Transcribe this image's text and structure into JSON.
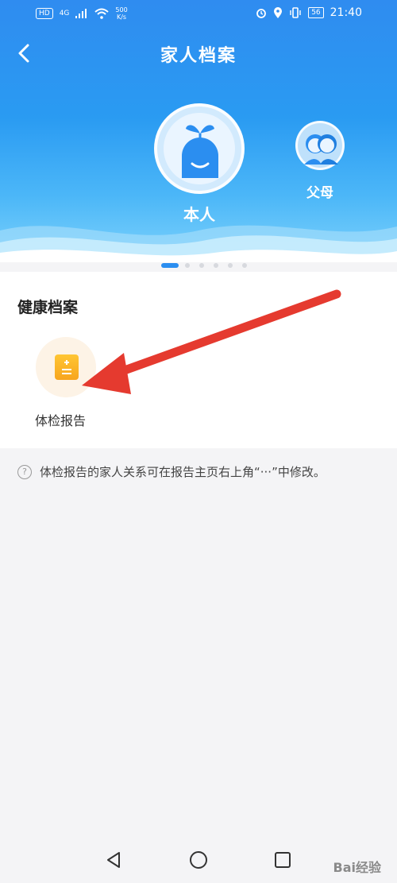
{
  "status_bar": {
    "hd_badge": "HD",
    "network": "4G",
    "speed_value": "500",
    "speed_unit": "K/s",
    "battery": "56",
    "time": "21:40"
  },
  "nav": {
    "title": "家人档案"
  },
  "profiles": [
    {
      "label": "本人",
      "selected": true
    },
    {
      "label": "父母",
      "selected": false
    }
  ],
  "pager": {
    "count": 6,
    "active_index": 0
  },
  "health_records": {
    "section_title": "健康档案",
    "items": [
      {
        "label": "体检报告",
        "icon": "report-icon"
      }
    ]
  },
  "tip": {
    "icon": "question-icon",
    "text": "体检报告的家人关系可在报告主页右上角“···”中修改。"
  },
  "system_nav": {
    "back": "back-triangle-icon",
    "home": "home-circle-icon",
    "recents": "recents-square-icon"
  },
  "watermark": "Bai经验",
  "colors": {
    "header_blue": "#2f8cf0",
    "accent_blue": "#2b8ef0",
    "arrow_red": "#e53a2f",
    "report_orange": "#f7a51e"
  }
}
